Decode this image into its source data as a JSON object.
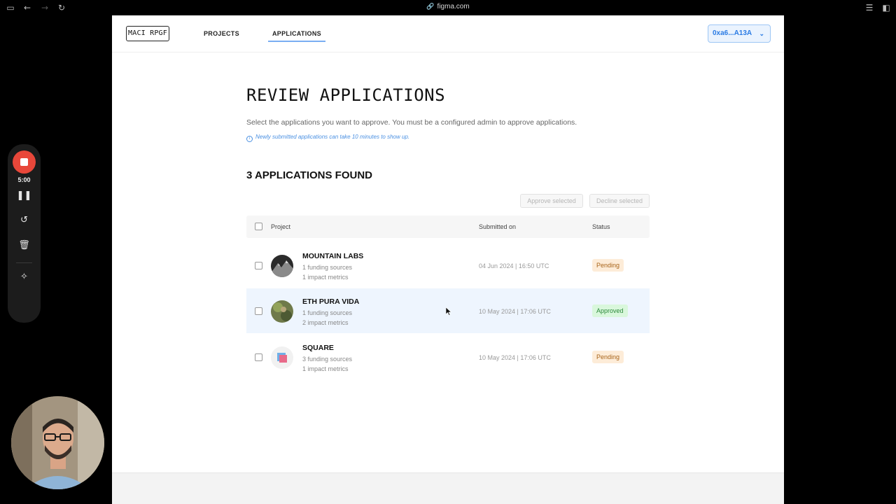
{
  "browser": {
    "url": "figma.com",
    "icons": [
      "sidebar-icon",
      "back-icon",
      "forward-icon",
      "reload-icon",
      "reader-icon",
      "split-view-icon"
    ]
  },
  "nav": {
    "logo": "MACI RPGF",
    "links": [
      {
        "label": "PROJECTS",
        "active": false
      },
      {
        "label": "APPLICATIONS",
        "active": true
      }
    ],
    "wallet": "0xa6...A13A"
  },
  "main": {
    "title": "REVIEW APPLICATIONS",
    "description": "Select the applications you want to approve. You must be a configured admin to approve applications.",
    "note": "Newly submitted applications can take 10 minutes to show up.",
    "count_heading": "3 APPLICATIONS FOUND",
    "approve_selected": "Approve selected",
    "decline_selected": "Decline selected",
    "table": {
      "headers": {
        "project": "Project",
        "submitted": "Submitted on",
        "status": "Status"
      },
      "rows": [
        {
          "name": "MOUNTAIN LABS",
          "funding": "1 funding sources",
          "impact": "1 impact metrics",
          "date": "04 Jun 2024 | 16:50 UTC",
          "status": "Pending"
        },
        {
          "name": "ETH PURA VIDA",
          "funding": "1 funding sources",
          "impact": "2 impact metrics",
          "date": "10 May 2024 | 17:06 UTC",
          "status": "Approved"
        },
        {
          "name": "SQUARE",
          "funding": "3 funding sources",
          "impact": "1 impact metrics",
          "date": "10 May 2024 | 17:06 UTC",
          "status": "Pending"
        }
      ]
    }
  },
  "recorder": {
    "time": "5:00"
  },
  "colors": {
    "accent": "#2a7be4",
    "pending_bg": "#fdecd8",
    "approved_bg": "#d9f7dc",
    "record": "#e8473a"
  }
}
